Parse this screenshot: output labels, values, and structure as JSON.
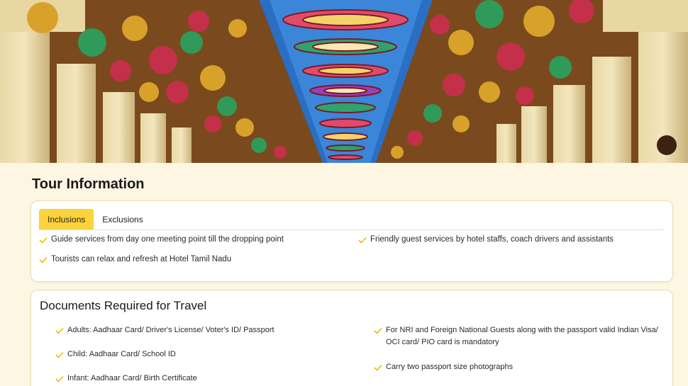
{
  "hero": {
    "image_alt": "Painted temple ceiling with carved columns"
  },
  "tour": {
    "title": "Tour Information",
    "tabs": [
      {
        "label": "Inclusions",
        "active": true
      },
      {
        "label": "Exclusions",
        "active": false
      }
    ],
    "inclusions": [
      "Guide services from day one meeting point till the dropping point",
      "Friendly guest services by hotel staffs, coach drivers and assistants",
      "Tourists can relax and refresh at Hotel Tamil Nadu"
    ]
  },
  "documents": {
    "title": "Documents Required for Travel",
    "items": [
      "Adults: Aadhaar Card/ Driver's License/ Voter's ID/ Passport",
      "For NRI and Foreign National Guests along with the passport valid Indian Visa/ OCI card/ PIO card is mandatory",
      "Child: Aadhaar Card/ School ID",
      "Carry two passport size photographs",
      "Infant: Aadhaar Card/ Birth Certificate"
    ]
  },
  "colors": {
    "accent": "#fcd33a",
    "check": "#f2b705",
    "page_bg": "#fdf6e3",
    "card_border": "#ecdcb0"
  },
  "icons": {
    "check": "check-icon"
  }
}
